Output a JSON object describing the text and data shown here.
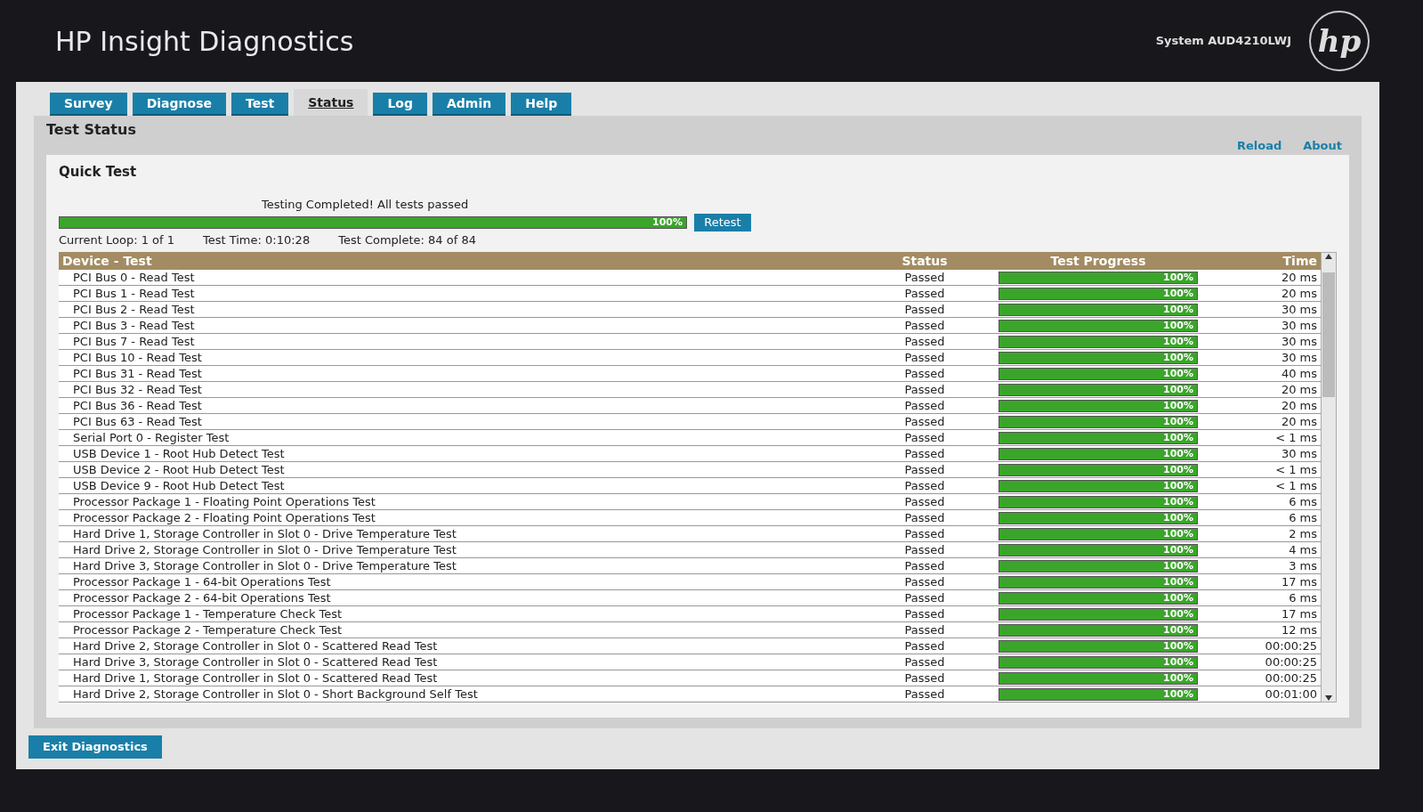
{
  "header": {
    "title": "HP Insight Diagnostics",
    "system": "System AUD4210LWJ",
    "logo": "hp"
  },
  "tabs": [
    {
      "label": "Survey",
      "selected": false
    },
    {
      "label": "Diagnose",
      "selected": false
    },
    {
      "label": "Test",
      "selected": false
    },
    {
      "label": "Status",
      "selected": true
    },
    {
      "label": "Log",
      "selected": false
    },
    {
      "label": "Admin",
      "selected": false
    },
    {
      "label": "Help",
      "selected": false
    }
  ],
  "page_title": "Test Status",
  "links": [
    "Reload",
    "About"
  ],
  "quick_test": {
    "title": "Quick Test",
    "message": "Testing Completed! All tests passed",
    "level": 1,
    "reading": "100%",
    "retest": "Retest",
    "current_loop": "Current Loop: 1 of 1",
    "test_time": "Test Time: 0:10:28",
    "test_complete": "Test Complete: 84 of 84"
  },
  "table": {
    "columns": [
      "Device - Test",
      "Status",
      "Test Progress",
      "Time"
    ],
    "rows": [
      {
        "test": "PCI Bus 0 - Read Test",
        "status": "Passed",
        "level": 1,
        "progress": "100%",
        "time": "20 ms"
      },
      {
        "test": "PCI Bus 1 - Read Test",
        "status": "Passed",
        "level": 1,
        "progress": "100%",
        "time": "20 ms"
      },
      {
        "test": "PCI Bus 2 - Read Test",
        "status": "Passed",
        "level": 1,
        "progress": "100%",
        "time": "30 ms"
      },
      {
        "test": "PCI Bus 3 - Read Test",
        "status": "Passed",
        "level": 1,
        "progress": "100%",
        "time": "30 ms"
      },
      {
        "test": "PCI Bus 7 - Read Test",
        "status": "Passed",
        "level": 1,
        "progress": "100%",
        "time": "30 ms"
      },
      {
        "test": "PCI Bus 10 - Read Test",
        "status": "Passed",
        "level": 1,
        "progress": "100%",
        "time": "30 ms"
      },
      {
        "test": "PCI Bus 31 - Read Test",
        "status": "Passed",
        "level": 1,
        "progress": "100%",
        "time": "40 ms"
      },
      {
        "test": "PCI Bus 32 - Read Test",
        "status": "Passed",
        "level": 1,
        "progress": "100%",
        "time": "20 ms"
      },
      {
        "test": "PCI Bus 36 - Read Test",
        "status": "Passed",
        "level": 1,
        "progress": "100%",
        "time": "20 ms"
      },
      {
        "test": "PCI Bus 63 - Read Test",
        "status": "Passed",
        "level": 1,
        "progress": "100%",
        "time": "20 ms"
      },
      {
        "test": "Serial Port 0 - Register Test",
        "status": "Passed",
        "level": 1,
        "progress": "100%",
        "time": "< 1 ms"
      },
      {
        "test": "USB Device 1 - Root Hub Detect Test",
        "status": "Passed",
        "level": 1,
        "progress": "100%",
        "time": "30 ms"
      },
      {
        "test": "USB Device 2 - Root Hub Detect Test",
        "status": "Passed",
        "level": 1,
        "progress": "100%",
        "time": "< 1 ms"
      },
      {
        "test": "USB Device 9 - Root Hub Detect Test",
        "status": "Passed",
        "level": 1,
        "progress": "100%",
        "time": "< 1 ms"
      },
      {
        "test": "Processor Package 1 - Floating Point Operations Test",
        "status": "Passed",
        "level": 1,
        "progress": "100%",
        "time": "6 ms"
      },
      {
        "test": "Processor Package 2 - Floating Point Operations Test",
        "status": "Passed",
        "level": 1,
        "progress": "100%",
        "time": "6 ms"
      },
      {
        "test": "Hard Drive 1, Storage Controller in Slot 0 - Drive Temperature Test",
        "status": "Passed",
        "level": 1,
        "progress": "100%",
        "time": "2 ms"
      },
      {
        "test": "Hard Drive 2, Storage Controller in Slot 0 - Drive Temperature Test",
        "status": "Passed",
        "level": 1,
        "progress": "100%",
        "time": "4 ms"
      },
      {
        "test": "Hard Drive 3, Storage Controller in Slot 0 - Drive Temperature Test",
        "status": "Passed",
        "level": 1,
        "progress": "100%",
        "time": "3 ms"
      },
      {
        "test": "Processor Package 1 - 64-bit Operations Test",
        "status": "Passed",
        "level": 1,
        "progress": "100%",
        "time": "17 ms"
      },
      {
        "test": "Processor Package 2 - 64-bit Operations Test",
        "status": "Passed",
        "level": 1,
        "progress": "100%",
        "time": "6 ms"
      },
      {
        "test": "Processor Package 1 - Temperature Check Test",
        "status": "Passed",
        "level": 1,
        "progress": "100%",
        "time": "17 ms"
      },
      {
        "test": "Processor Package 2 - Temperature Check Test",
        "status": "Passed",
        "level": 1,
        "progress": "100%",
        "time": "12 ms"
      },
      {
        "test": "Hard Drive 2, Storage Controller in Slot 0 - Scattered Read Test",
        "status": "Passed",
        "level": 1,
        "progress": "100%",
        "time": "00:00:25"
      },
      {
        "test": "Hard Drive 3, Storage Controller in Slot 0 - Scattered Read Test",
        "status": "Passed",
        "level": 1,
        "progress": "100%",
        "time": "00:00:25"
      },
      {
        "test": "Hard Drive 1, Storage Controller in Slot 0 - Scattered Read Test",
        "status": "Passed",
        "level": 1,
        "progress": "100%",
        "time": "00:00:25"
      },
      {
        "test": "Hard Drive 2, Storage Controller in Slot 0 - Short Background Self Test",
        "status": "Passed",
        "level": 1,
        "progress": "100%",
        "time": "00:01:00"
      }
    ]
  },
  "exit_button": "Exit Diagnostics"
}
